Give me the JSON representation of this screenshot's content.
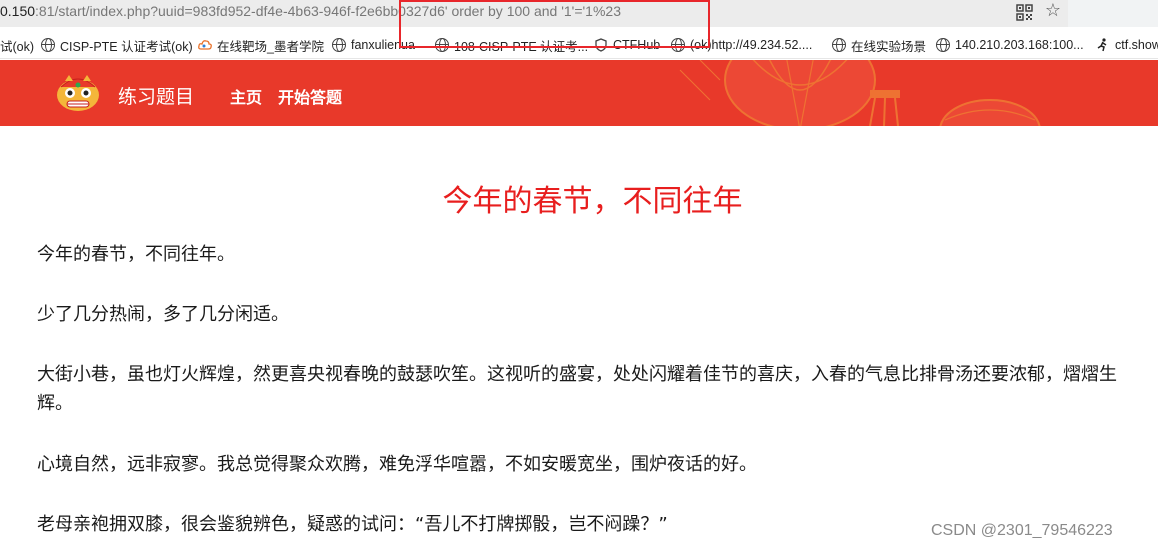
{
  "browser": {
    "url_host": "0.150",
    "url_rest": ":81/start/index.php?uuid=983fd952-df4e-4b63-946f-f2e6bb0327d6' order by 100 and '1'='1%23",
    "bookmarks": [
      {
        "label": "试(ok)",
        "icon": "none"
      },
      {
        "label": "CISP-PTE 认证考试(ok)",
        "icon": "globe-icon"
      },
      {
        "label": "在线靶场_墨者学院",
        "icon": "cloud-icon"
      },
      {
        "label": "fanxulienua",
        "icon": "globe-icon"
      },
      {
        "label": "108-CISP-PTE 认证考...",
        "icon": "globe-icon"
      },
      {
        "label": "CTFHub",
        "icon": "shield-icon"
      },
      {
        "label": "(ok)http://49.234.52....",
        "icon": "globe-icon"
      },
      {
        "label": "在线实验场景",
        "icon": "globe-icon"
      },
      {
        "label": "140.210.203.168:100...",
        "icon": "globe-icon"
      },
      {
        "label": "ctf.show",
        "icon": "runner-icon"
      }
    ]
  },
  "header": {
    "brand": "练习题目",
    "nav": [
      "主页",
      "开始答题"
    ]
  },
  "article": {
    "title": "今年的春节，不同往年",
    "paragraphs": [
      "今年的春节，不同往年。",
      "少了几分热闹，多了几分闲适。",
      "大街小巷，虽也灯火辉煌，然更喜央视春晚的鼓瑟吹笙。这视听的盛宴，处处闪耀着佳节的喜庆，入春的气息比排骨汤还要浓郁，熠熠生辉。",
      "心境自然，远非寂寥。我总觉得聚众欢腾，难免浮华喧嚣，不如安暖宽坐，围炉夜话的好。",
      "老母亲袍拥双膝，很会鉴貌辨色，疑惑的试问：“吾儿不打牌掷骰，岂不闷躁？”"
    ]
  },
  "watermark": "CSDN @2301_79546223",
  "colors": {
    "header_red": "#e8392a",
    "title_red": "#e81e1e",
    "highlight_box": "#e8262b"
  }
}
